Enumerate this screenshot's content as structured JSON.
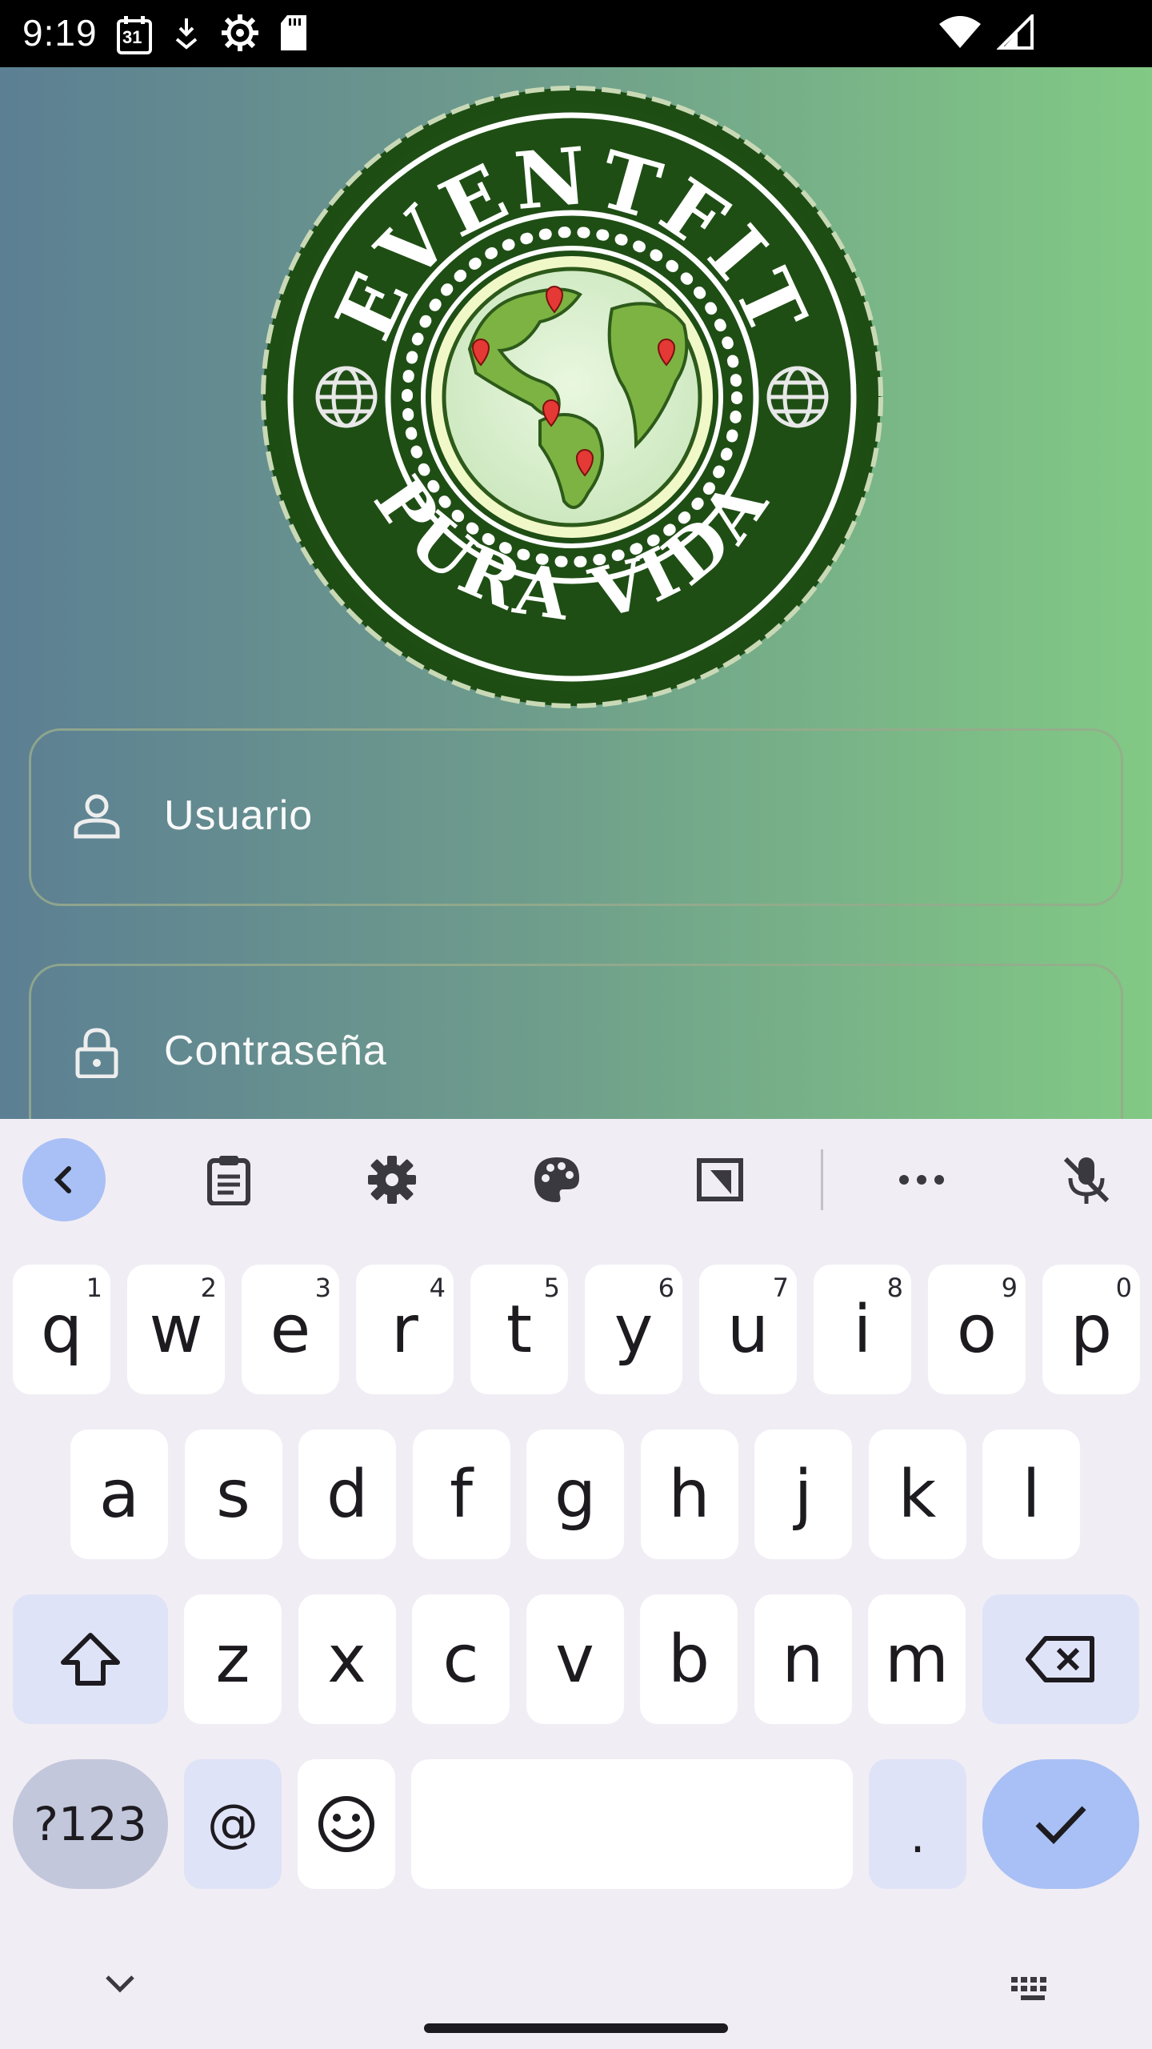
{
  "status_bar": {
    "time": "9:19",
    "calendar_day": "31",
    "left_icons": [
      "calendar-icon",
      "download-icon",
      "settings-icon",
      "sd-card-icon"
    ],
    "right_icons": [
      "wifi-icon",
      "signal-icon"
    ]
  },
  "logo": {
    "top_text": "EVENTFIT",
    "bottom_text": "PURA VIDA",
    "colors": {
      "ring": "#1e4d14",
      "globe_land": "#8bc34a",
      "pin": "#e53935"
    }
  },
  "form": {
    "username_placeholder": "Usuario",
    "password_placeholder": "Contraseña"
  },
  "keyboard": {
    "toolbar": [
      "back-icon",
      "clipboard-icon",
      "settings-icon",
      "palette-icon",
      "crop-icon",
      "more-icon",
      "mic-off-icon"
    ],
    "row1": [
      {
        "k": "q",
        "h": "1"
      },
      {
        "k": "w",
        "h": "2"
      },
      {
        "k": "e",
        "h": "3"
      },
      {
        "k": "r",
        "h": "4"
      },
      {
        "k": "t",
        "h": "5"
      },
      {
        "k": "y",
        "h": "6"
      },
      {
        "k": "u",
        "h": "7"
      },
      {
        "k": "i",
        "h": "8"
      },
      {
        "k": "o",
        "h": "9"
      },
      {
        "k": "p",
        "h": "0"
      }
    ],
    "row2": [
      "a",
      "s",
      "d",
      "f",
      "g",
      "h",
      "j",
      "k",
      "l"
    ],
    "row3": [
      "z",
      "x",
      "c",
      "v",
      "b",
      "n",
      "m"
    ],
    "symbols_label": "?123",
    "at_label": "@",
    "period_label": ".",
    "colors": {
      "accent": "#a8c0f5",
      "modifier": "#dfe3f7",
      "symbols": "#c3c7db"
    }
  }
}
